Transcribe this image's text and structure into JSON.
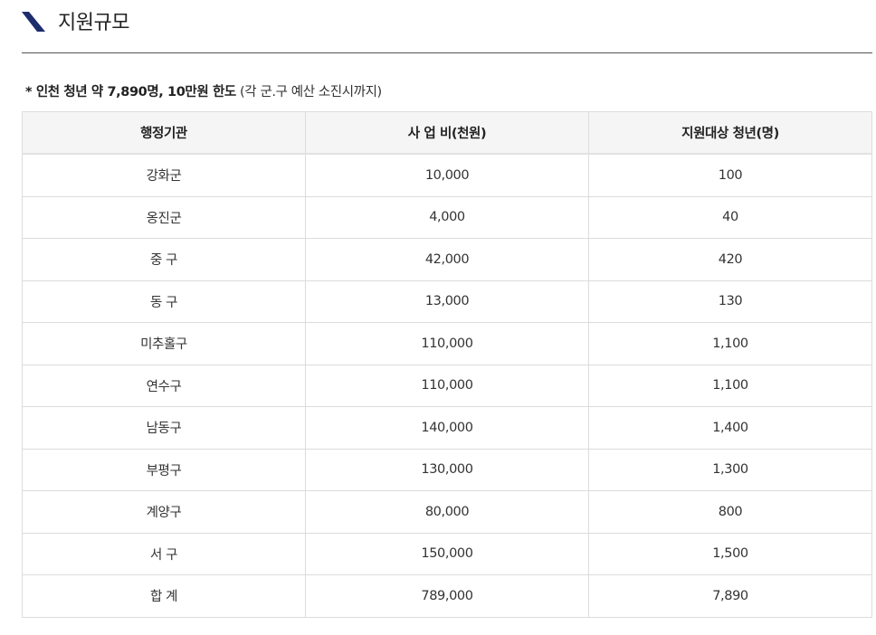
{
  "title": "지원규모",
  "note": {
    "bullet": "* ",
    "bold_text": "인천 청년 약 7,890명, 10만원 한도",
    "normal_text": " (각 군.구 예산 소진시까지)"
  },
  "table": {
    "headers": [
      "행정기관",
      "사 업 비(천원)",
      "지원대상 청년(명)"
    ],
    "rows": [
      [
        "강화군",
        "10,000",
        "100"
      ],
      [
        "옹진군",
        "4,000",
        "40"
      ],
      [
        "중 구",
        "42,000",
        "420"
      ],
      [
        "동 구",
        "13,000",
        "130"
      ],
      [
        "미추홀구",
        "110,000",
        "1,100"
      ],
      [
        "연수구",
        "110,000",
        "1,100"
      ],
      [
        "남동구",
        "140,000",
        "1,400"
      ],
      [
        "부평구",
        "130,000",
        "1,300"
      ],
      [
        "계양구",
        "80,000",
        "800"
      ],
      [
        "서 구",
        "150,000",
        "1,500"
      ],
      [
        "합 계",
        "789,000",
        "7,890"
      ]
    ]
  },
  "colors": {
    "accent": "#1e2d6b",
    "header_bg": "#f5f5f5",
    "border": "#dcdcdc"
  },
  "icons": {
    "title_mark": "slash-mark-icon"
  }
}
